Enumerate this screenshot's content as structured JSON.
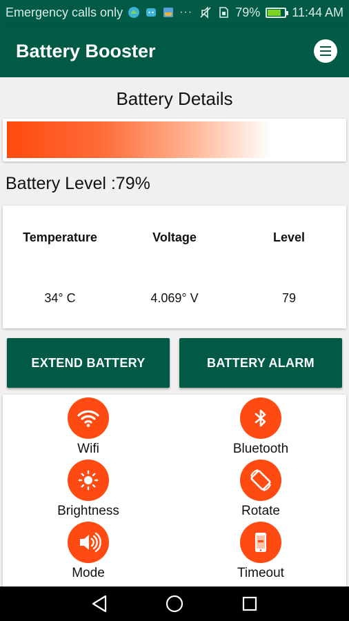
{
  "status_bar": {
    "carrier": "Emergency calls only",
    "dots": "···",
    "battery_percent": "79%",
    "battery_fraction": 0.79,
    "time": "11:44 AM"
  },
  "app_bar": {
    "title": "Battery Booster",
    "menu_icon": "menu-icon"
  },
  "battery": {
    "section_title": "Battery Details",
    "level_fraction": 0.79,
    "level_label": "Battery Level :79%"
  },
  "details": {
    "headers": [
      "Temperature",
      "Voltage",
      "Level"
    ],
    "values": [
      "34° C",
      "4.069° V",
      "79"
    ]
  },
  "actions": {
    "extend_label": "EXTEND BATTERY",
    "alarm_label": "BATTERY ALARM"
  },
  "toggles": [
    {
      "label": "Wifi",
      "icon": "wifi-icon"
    },
    {
      "label": "Bluetooth",
      "icon": "bluetooth-icon"
    },
    {
      "label": "Brightness",
      "icon": "brightness-icon"
    },
    {
      "label": "Rotate",
      "icon": "rotate-icon"
    },
    {
      "label": "Mode",
      "icon": "volume-icon"
    },
    {
      "label": "Timeout",
      "icon": "phone-timeout-icon"
    }
  ],
  "colors": {
    "primary": "#005a46",
    "accent": "#ff4a12"
  },
  "nav": {
    "back_icon": "back-icon",
    "home_icon": "home-icon",
    "recents_icon": "recents-icon"
  }
}
